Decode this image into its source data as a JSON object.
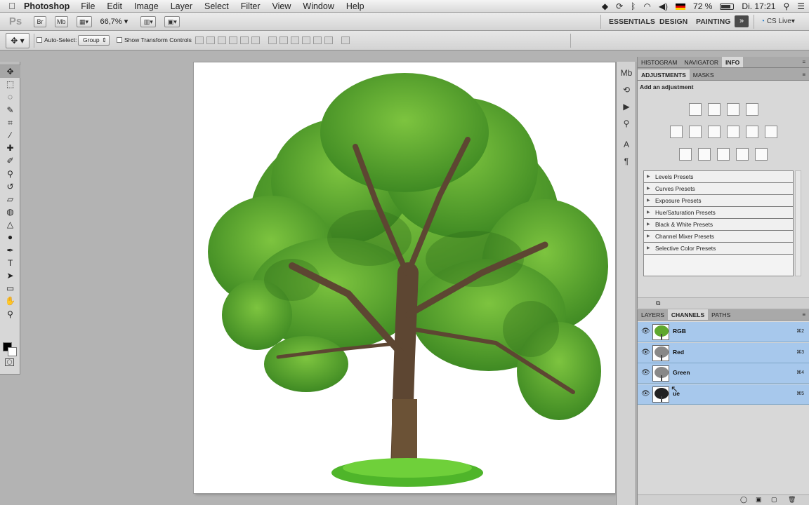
{
  "menubar": {
    "app_name": "Photoshop",
    "items": [
      "File",
      "Edit",
      "Image",
      "Layer",
      "Select",
      "Filter",
      "View",
      "Window",
      "Help"
    ],
    "battery": "72 %",
    "clock": "Di. 17:21"
  },
  "appbar": {
    "logo": "Ps",
    "bridge_btn": "Br",
    "minibridge_btn": "Mb",
    "zoom": "66,7%",
    "workspaces": [
      "ESSENTIALS",
      "DESIGN",
      "PAINTING"
    ],
    "more": "»",
    "cs_live": "CS Live"
  },
  "options": {
    "auto_select_label": "Auto-Select:",
    "auto_select_value": "Group",
    "transform_label": "Show Transform Controls"
  },
  "tools": [
    {
      "icon": "move-tool-icon",
      "glyph": "✥",
      "selected": true
    },
    {
      "icon": "marquee-tool-icon",
      "glyph": "⬚"
    },
    {
      "icon": "lasso-tool-icon",
      "glyph": "◌"
    },
    {
      "icon": "quick-select-tool-icon",
      "glyph": "✎"
    },
    {
      "icon": "crop-tool-icon",
      "glyph": "⌗"
    },
    {
      "icon": "eyedropper-tool-icon",
      "glyph": "⁄"
    },
    {
      "icon": "healing-brush-tool-icon",
      "glyph": "✚"
    },
    {
      "icon": "brush-tool-icon",
      "glyph": "✐"
    },
    {
      "icon": "clone-stamp-tool-icon",
      "glyph": "⚲"
    },
    {
      "icon": "history-brush-tool-icon",
      "glyph": "↺"
    },
    {
      "icon": "eraser-tool-icon",
      "glyph": "▱"
    },
    {
      "icon": "paint-bucket-tool-icon",
      "glyph": "◍"
    },
    {
      "icon": "blur-tool-icon",
      "glyph": "△"
    },
    {
      "icon": "dodge-tool-icon",
      "glyph": "●"
    },
    {
      "icon": "pen-tool-icon",
      "glyph": "✒"
    },
    {
      "icon": "type-tool-icon",
      "glyph": "T"
    },
    {
      "icon": "path-select-tool-icon",
      "glyph": "➤"
    },
    {
      "icon": "shape-tool-icon",
      "glyph": "▭"
    },
    {
      "icon": "hand-tool-icon",
      "glyph": "✋"
    },
    {
      "icon": "zoom-tool-icon",
      "glyph": "⚲"
    }
  ],
  "dock": [
    {
      "icon": "minibridge-dock-icon",
      "glyph": "Mb"
    },
    {
      "icon": "history-dock-icon",
      "glyph": "⟲"
    },
    {
      "icon": "actions-dock-icon",
      "glyph": "▶"
    },
    {
      "icon": "clone-source-dock-icon",
      "glyph": "⚲"
    },
    {
      "icon": "character-dock-icon",
      "glyph": "A"
    },
    {
      "icon": "paragraph-dock-icon",
      "glyph": "¶"
    }
  ],
  "top_panel": {
    "tabs": [
      "HISTOGRAM",
      "NAVIGATOR",
      "INFO"
    ],
    "active": 2
  },
  "adjustments": {
    "tabs": [
      "ADJUSTMENTS",
      "MASKS"
    ],
    "title": "Add an adjustment",
    "icons": [
      [
        "brightness-contrast-icon",
        "levels-icon",
        "curves-icon",
        "exposure-icon"
      ],
      [
        "vibrance-icon",
        "hue-saturation-icon",
        "color-balance-icon",
        "black-white-icon",
        "photo-filter-icon",
        "channel-mixer-icon"
      ],
      [
        "invert-icon",
        "posterize-icon",
        "threshold-icon",
        "gradient-map-icon",
        "selective-color-icon"
      ]
    ],
    "presets": [
      "Levels Presets",
      "Curves Presets",
      "Exposure Presets",
      "Hue/Saturation Presets",
      "Black & White Presets",
      "Channel Mixer Presets",
      "Selective Color Presets"
    ]
  },
  "layers_panel": {
    "tabs": [
      "LAYERS",
      "CHANNELS",
      "PATHS"
    ],
    "active": 1,
    "channels": [
      {
        "name": "RGB",
        "shortcut": "⌘2",
        "thumb": "color"
      },
      {
        "name": "Red",
        "shortcut": "⌘3",
        "thumb": "gray"
      },
      {
        "name": "Green",
        "shortcut": "⌘4",
        "thumb": "gray"
      },
      {
        "name": "Blue",
        "display": "ue",
        "shortcut": "⌘5",
        "thumb": "dark"
      }
    ]
  },
  "colors": {
    "canvas_bg": "#b3b3b3",
    "channel_selected": "#a7c8ec",
    "leaf": "#5fa82e",
    "trunk": "#6b5236",
    "grass": "#4fb52a"
  }
}
